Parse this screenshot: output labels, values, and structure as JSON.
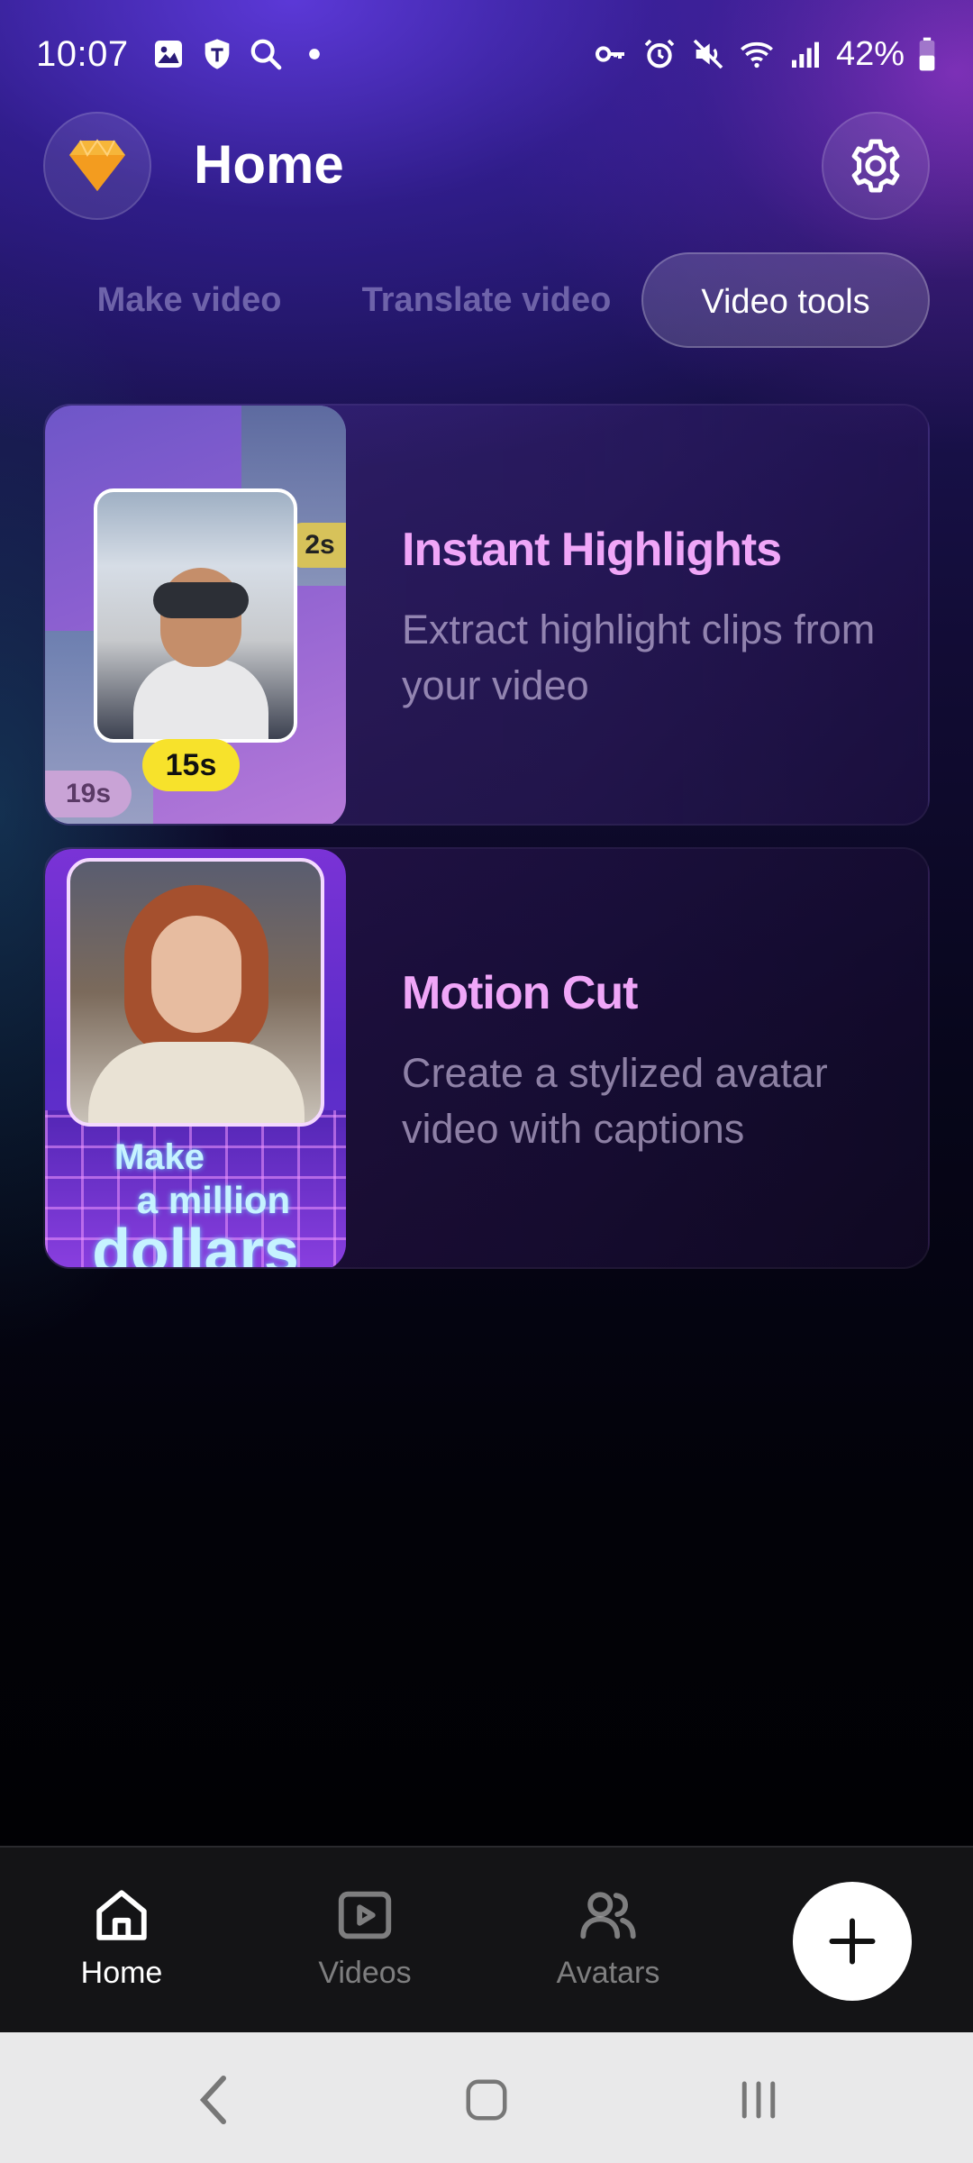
{
  "status_bar": {
    "time": "10:07",
    "battery": "42%"
  },
  "header": {
    "title": "Home"
  },
  "tabs": [
    {
      "label": "Make video",
      "active": false
    },
    {
      "label": "Translate video",
      "active": false
    },
    {
      "label": "Video tools",
      "active": true
    }
  ],
  "cards": [
    {
      "title": "Instant Highlights",
      "description": "Extract highlight clips from your video",
      "badges": [
        "15s",
        "2s",
        "19s"
      ]
    },
    {
      "title": "Motion Cut",
      "description": "Create a stylized avatar video with captions",
      "thumb_text": [
        "Make",
        "a million",
        "dollars"
      ]
    }
  ],
  "bottom_nav": {
    "items": [
      {
        "label": "Home",
        "icon": "home-icon",
        "active": true
      },
      {
        "label": "Videos",
        "icon": "play-square-icon",
        "active": false
      },
      {
        "label": "Avatars",
        "icon": "people-icon",
        "active": false
      }
    ],
    "fab_icon": "plus-icon"
  },
  "colors": {
    "accent_title": "#f0a6f8",
    "badge_yellow": "#f7e22b",
    "premium_gold": "#f6b63a"
  }
}
